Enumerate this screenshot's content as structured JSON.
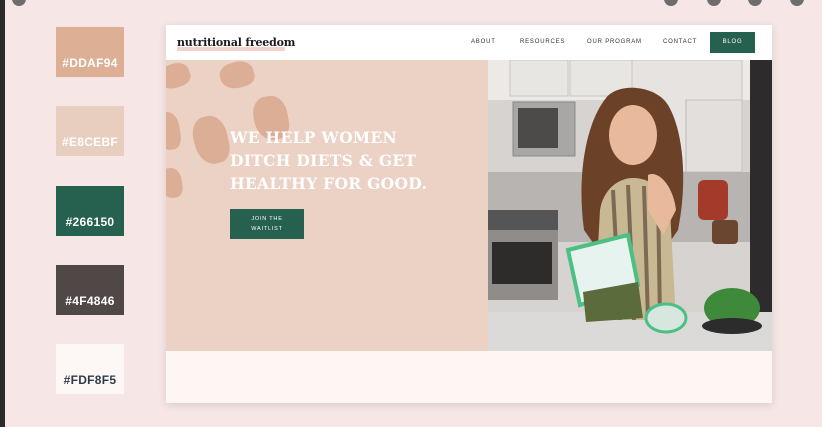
{
  "palette": [
    {
      "label": "#DDAF94",
      "color": "#DDAF94"
    },
    {
      "label": "#E8CEBF",
      "color": "#E8CEBF"
    },
    {
      "label": "#266150",
      "color": "#266150"
    },
    {
      "label": "#4F4846",
      "color": "#4F4846"
    },
    {
      "label": "#FDF8F5",
      "color": "#FDF8F5"
    }
  ],
  "site": {
    "logo": "nutritional freedom",
    "nav": {
      "about": "ABOUT",
      "resources": "RESOURCES",
      "program": "OUR PROGRAM",
      "contact": "CONTACT",
      "blog": "BLOG"
    },
    "hero": {
      "line1": "WE HELP WOMEN",
      "line2": "DITCH DIETS & GET",
      "line3": "HEALTHY FOR GOOD.",
      "cta_line1": "JOIN THE",
      "cta_line2": "WAITLIST"
    }
  }
}
